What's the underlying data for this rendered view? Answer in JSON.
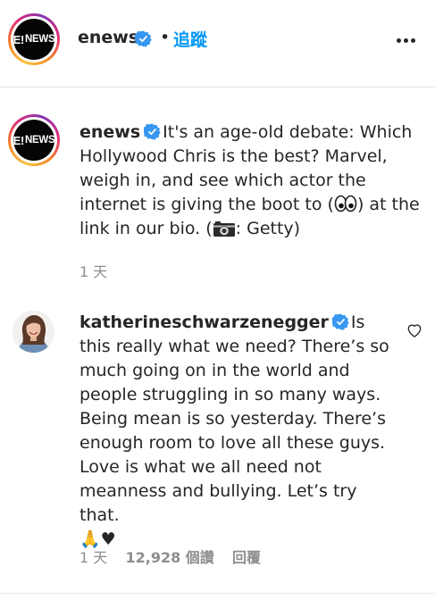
{
  "header": {
    "username": "enews",
    "follow_label": "追蹤",
    "dot": "•",
    "logo_e": "E!",
    "logo_news": "NEWS"
  },
  "caption": {
    "username": "enews",
    "text_1": "It's an age-old debate: Which Hollywood Chris is the best? Marvel, weigh in, and see which actor the internet is giving the boot to (",
    "text_2": ") at the link in our bio. (",
    "text_3": ": Getty)",
    "time": "1 天"
  },
  "comment": {
    "username": "katherineschwarzenegger",
    "text": "Is this really what we need? There’s so much going on in the world and people struggling in so many ways. Being mean is so yesterday. There’s enough room to love all these guys. Love is what we all need not meanness and bullying. Let’s try that.",
    "emojis": "🙏♥",
    "time": "1 天",
    "likes": "12,928 個讚",
    "reply_label": "回覆"
  },
  "colors": {
    "accent": "#0095f6",
    "text": "#262626",
    "muted": "#8e8e8e",
    "verified": "#3897f0"
  }
}
